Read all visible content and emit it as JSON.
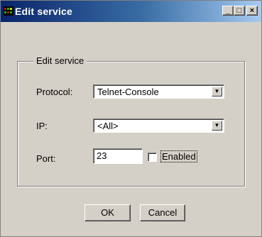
{
  "window": {
    "title": "Edit service",
    "controls": {
      "minimize": "_",
      "maximize": "□",
      "close": "×"
    },
    "icon": "app-icon"
  },
  "group": {
    "legend": "Edit service"
  },
  "form": {
    "protocol_label": "Protocol:",
    "protocol_value": "Telnet-Console",
    "ip_label": "IP:",
    "ip_value": "<All>",
    "port_label": "Port:",
    "port_value": "23",
    "enabled_label": "Enabled",
    "enabled_checked": false
  },
  "buttons": {
    "ok": "OK",
    "cancel": "Cancel"
  },
  "colors": {
    "face": "#d4d0c8",
    "title_start": "#0a246a",
    "title_end": "#a6caf0"
  }
}
